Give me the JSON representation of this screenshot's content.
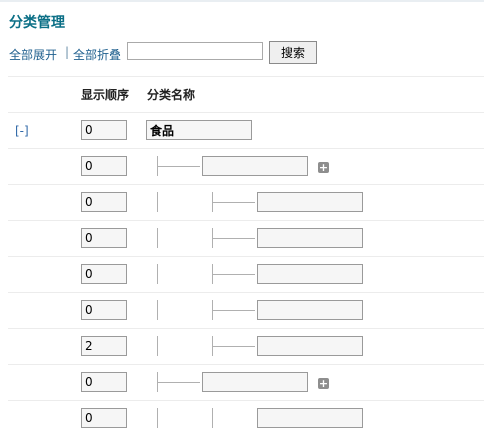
{
  "header": {
    "title": "分类管理"
  },
  "toolbar": {
    "expand_all": "全部展开",
    "separator": "|",
    "collapse_all": "全部折叠",
    "search_value": "",
    "search_button": "搜索"
  },
  "columns": {
    "order": "显示顺序",
    "name": "分类名称"
  },
  "rows": [
    {
      "toggle": "[-]",
      "order": "0",
      "name": "食品",
      "level": 0
    },
    {
      "order": "0",
      "name": "",
      "level": 1,
      "add_icon": "plus-icon"
    },
    {
      "order": "0",
      "name": "",
      "level": 2
    },
    {
      "order": "0",
      "name": "",
      "level": 2
    },
    {
      "order": "0",
      "name": "",
      "level": 2
    },
    {
      "order": "0",
      "name": "",
      "level": 2
    },
    {
      "order": "2",
      "name": "",
      "level": 2
    },
    {
      "order": "0",
      "name": "",
      "level": 1,
      "add_icon": "plus-icon"
    },
    {
      "order": "0",
      "name": "",
      "level": 2
    }
  ]
}
